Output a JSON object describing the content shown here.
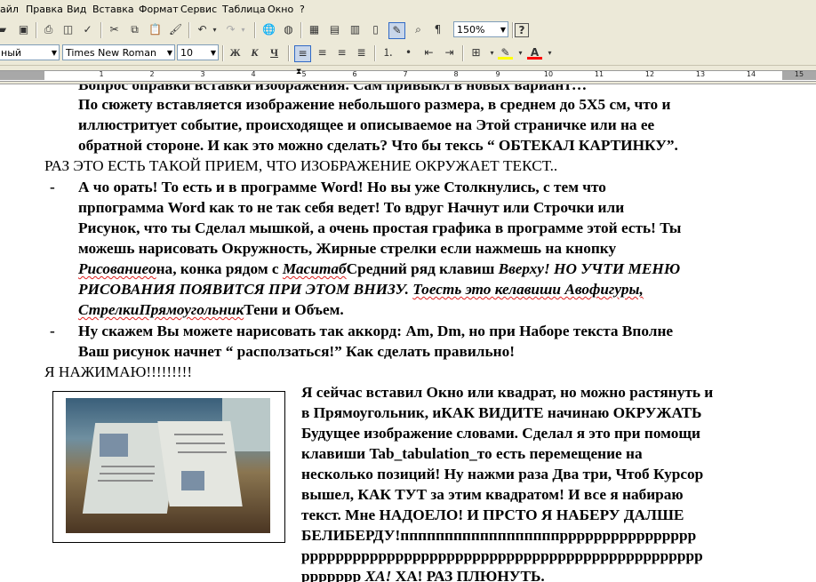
{
  "menu": [
    "айл",
    "Правка",
    "Вид",
    "Вставка",
    "Формат",
    "Сервис",
    "Таблица",
    "Окно",
    "?"
  ],
  "toolbar": {
    "zoom": "150%",
    "style": "ный",
    "font": "Times New Roman",
    "size": "10",
    "bold": "Ж",
    "italic": "К",
    "underline": "Ч",
    "help": "?",
    "pilcrow": "¶"
  },
  "ruler": {
    "numbers": [
      "1",
      "2",
      "3",
      "4",
      "5",
      "6",
      "7",
      "8",
      "9",
      "10",
      "11",
      "12",
      "13",
      "14",
      "15"
    ]
  },
  "doc": {
    "l0": "Вопрос оправки вставки изображения. Сам привыкл в новых вариант…",
    "l1": "По сюжету вставляется изображение небольшого размера, в среднем до 5Х5 см, что и",
    "l2": "иллюстритует событие, происходящее и описываемое на Этой страничке или на ее",
    "l3": "обратной стороне. И как это можно сделать? Что бы тeкcь “ ОБТЕКАЛ КАРТИНКУ”.",
    "l4": "РАЗ ЭТО ЕСТЬ ТАКОЙ ПРИЕМ, ЧТО ИЗОБРАЖЕНИЕ ОКРУЖАЕТ ТЕКСТ..",
    "bullet": "-",
    "l5": "А чо орать! То есть и в программе Word! Но вы уже Столкнулись, с тем что",
    "l6": "прпограмма Word как то не так себя ведет! То вдруг Начнут или Строчки или",
    "l7": "Рисунок, что ты Сделал мышкой, а очень простая графика в программе этой есть! Ты",
    "l8": "можешь нарисовать Окружность, Жирные стрелки если нажмешь на кнопку",
    "l9a": "Рисованиео",
    "l9b": "на, конка рядом с ",
    "l9c": "Маситаб",
    "l9d": "Средний ряд клавиш ",
    "l9e": "Вверху! НО УЧТИ МЕНЮ",
    "l10a": "РИСОВАНИЯ ПОЯВИТСЯ ПРИ ЭТОМ ВНИЗУ. ",
    "l10b": "Тоесть это келавиши Авофигуры,",
    "l11a": "СтрелкиПрямоугольник",
    "l11b": "Тени и Объем.",
    "l12": "Ну скажем Вы можете нарисовать так аккорд: Am, Dm, но при Наборе текста Вполне",
    "l13": "Ваш рисунок начнет “ расползаться!” Как сделать правильно!",
    "l14": "Я НАЖИМАЮ!!!!!!!!!",
    "r1": "Я сейчас вставил Окно или квадрат, но можно растянуть и",
    "r2": "в Прямоугольник, иКАК ВИДИТЕ начинаю ОКРУЖАТЬ",
    "r3": "Будущее изображение словами. Сделал я это при помощи",
    "r4": "клавиши Tab_tabulation_то есть перемещение на",
    "r5": "несколько позиций! Ну нажми раза Два три, Чтоб Курсор",
    "r6": "вышел, КАК ТУТ за этим квадратом! И все я набираю",
    "r7": "текст. Мне НАДОЕЛО! И ПРСТО Я НАБЕРУ ДАЛШЕ",
    "r8": "БЕЛИБЕРДУ!ппппппппппппппппппрррррррррррррррр",
    "r9": "ррррррррррррррррррррррррррррррррррррррррррррррр",
    "r10a": "ррррррр ",
    "r10b": "ХА!",
    "r10c": " ХА!  РАЗ ПЛЮНУТЬ."
  }
}
